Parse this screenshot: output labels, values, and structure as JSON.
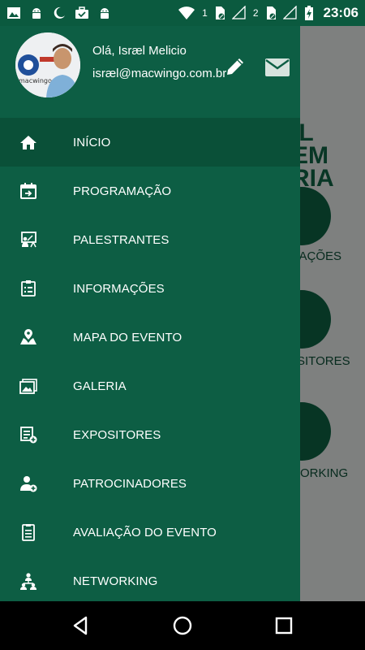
{
  "status_bar": {
    "sim1_label": "1",
    "sim2_label": "2",
    "time": "23:06",
    "icons": [
      "image-icon",
      "android-icon",
      "moon-icon",
      "briefcase-icon",
      "android-icon",
      "wifi-icon",
      "signal-icon",
      "battery-icon"
    ]
  },
  "background": {
    "banner_lines": [
      "IL",
      "EM",
      "RIA"
    ],
    "labels": [
      "MAÇÕES",
      "SITORES",
      "ORKING"
    ]
  },
  "drawer": {
    "greeting": "Olá, Isræl Melicio",
    "email": "isræl@macwingo.com.br",
    "avatar_logo_text": "macwingo",
    "items": [
      {
        "label": "INÍCIO",
        "icon": "home-icon",
        "active": true
      },
      {
        "label": "PROGRAMAÇÃO",
        "icon": "calendar-icon",
        "active": false
      },
      {
        "label": "PALESTRANTES",
        "icon": "presenter-icon",
        "active": false
      },
      {
        "label": "INFORMAÇÕES",
        "icon": "clipboard-list-icon",
        "active": false
      },
      {
        "label": "MAPA DO EVENTO",
        "icon": "map-icon",
        "active": false
      },
      {
        "label": "GALERIA",
        "icon": "gallery-icon",
        "active": false
      },
      {
        "label": "EXPOSITORES",
        "icon": "exhibitor-list-icon",
        "active": false
      },
      {
        "label": "PATROCINADORES",
        "icon": "sponsor-icon",
        "active": false
      },
      {
        "label": "AVALIAÇÃO DO EVENTO",
        "icon": "evaluation-icon",
        "active": false
      },
      {
        "label": "NETWORKING",
        "icon": "networking-icon",
        "active": false
      }
    ]
  },
  "colors": {
    "status_bar": "#0b5a3f",
    "drawer": "#0d5e44",
    "drawer_active": "#0a5038",
    "accent_text": "#ffffff"
  }
}
